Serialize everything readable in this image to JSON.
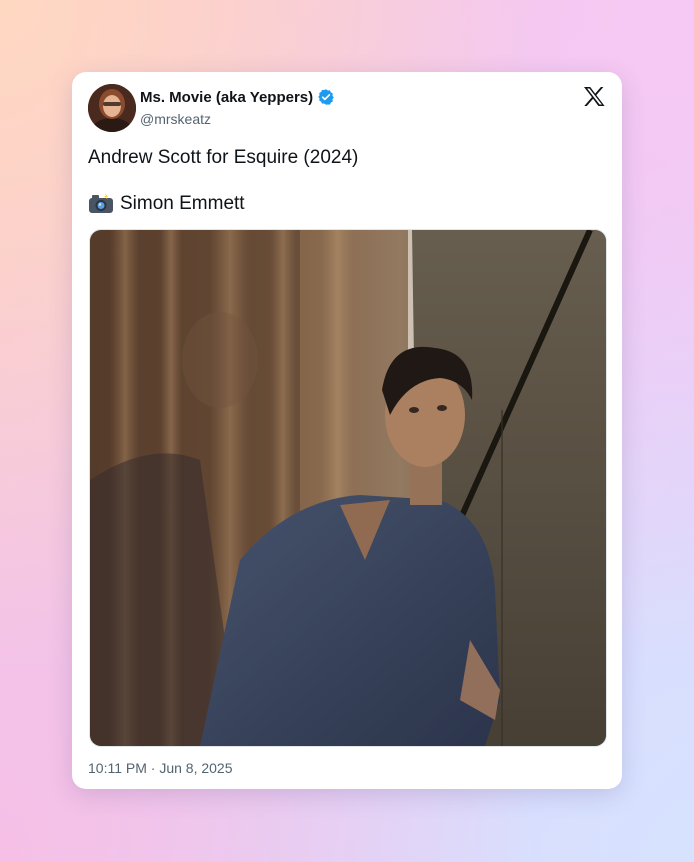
{
  "author": {
    "display_name": "Ms. Movie (aka Yeppers)",
    "handle": "@mrskeatz",
    "verified": true,
    "avatar_icon": "profile-avatar"
  },
  "tweet": {
    "text_line1": "Andrew Scott for Esquire (2024)",
    "camera_icon": "camera-flash-emoji",
    "text_line2": "Simon Emmett",
    "timestamp": "10:11 PM · Jun 8, 2025"
  },
  "media": {
    "kind": "photo"
  },
  "brand": {
    "logo_icon": "x-logo-icon",
    "verified_color": "#1d9bf0",
    "text_color": "#0f1419",
    "muted_color": "#536471"
  }
}
